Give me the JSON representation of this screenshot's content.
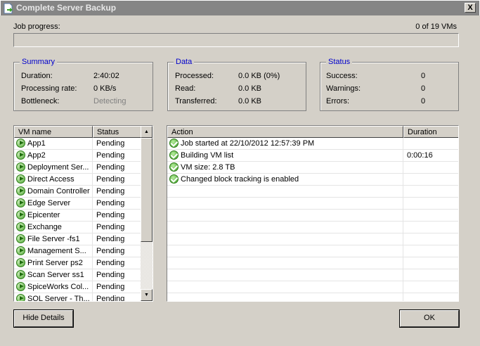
{
  "window": {
    "title": "Complete Server Backup",
    "close": "X"
  },
  "progress": {
    "label": "Job progress:",
    "count": "0 of 19 VMs",
    "fraction": 0
  },
  "summary": {
    "title": "Summary",
    "rows": [
      {
        "label": "Duration:",
        "value": "2:40:02"
      },
      {
        "label": "Processing rate:",
        "value": "0 KB/s"
      },
      {
        "label": "Bottleneck:",
        "value": "Detecting"
      }
    ]
  },
  "data": {
    "title": "Data",
    "rows": [
      {
        "label": "Processed:",
        "value": "0.0 KB (0%)"
      },
      {
        "label": "Read:",
        "value": "0.0 KB"
      },
      {
        "label": "Transferred:",
        "value": "0.0 KB"
      }
    ]
  },
  "status": {
    "title": "Status",
    "rows": [
      {
        "label": "Success:",
        "value": "0"
      },
      {
        "label": "Warnings:",
        "value": "0"
      },
      {
        "label": "Errors:",
        "value": "0"
      }
    ]
  },
  "vm_list": {
    "headers": [
      "VM name",
      "Status"
    ],
    "rows": [
      {
        "name": "App1",
        "status": "Pending"
      },
      {
        "name": "App2",
        "status": "Pending"
      },
      {
        "name": "Deployment Ser...",
        "status": "Pending"
      },
      {
        "name": "Direct Access",
        "status": "Pending"
      },
      {
        "name": "Domain Controller",
        "status": "Pending"
      },
      {
        "name": "Edge Server",
        "status": "Pending"
      },
      {
        "name": "Epicenter",
        "status": "Pending"
      },
      {
        "name": "Exchange",
        "status": "Pending"
      },
      {
        "name": "File Server -fs1",
        "status": "Pending"
      },
      {
        "name": "Management S...",
        "status": "Pending"
      },
      {
        "name": "Print Server ps2",
        "status": "Pending"
      },
      {
        "name": "Scan Server ss1",
        "status": "Pending"
      },
      {
        "name": "SpiceWorks Col...",
        "status": "Pending"
      },
      {
        "name": "SQL Server - Th...",
        "status": "Pending"
      }
    ]
  },
  "action_list": {
    "headers": [
      "Action",
      "Duration"
    ],
    "rows": [
      {
        "action": "Job started at 22/10/2012 12:57:39 PM",
        "duration": ""
      },
      {
        "action": "Building VM list",
        "duration": "0:00:16"
      },
      {
        "action": "VM size: 2.8 TB",
        "duration": ""
      },
      {
        "action": "Changed block tracking is enabled",
        "duration": ""
      }
    ]
  },
  "buttons": {
    "hide_details": "Hide Details",
    "ok": "OK"
  }
}
